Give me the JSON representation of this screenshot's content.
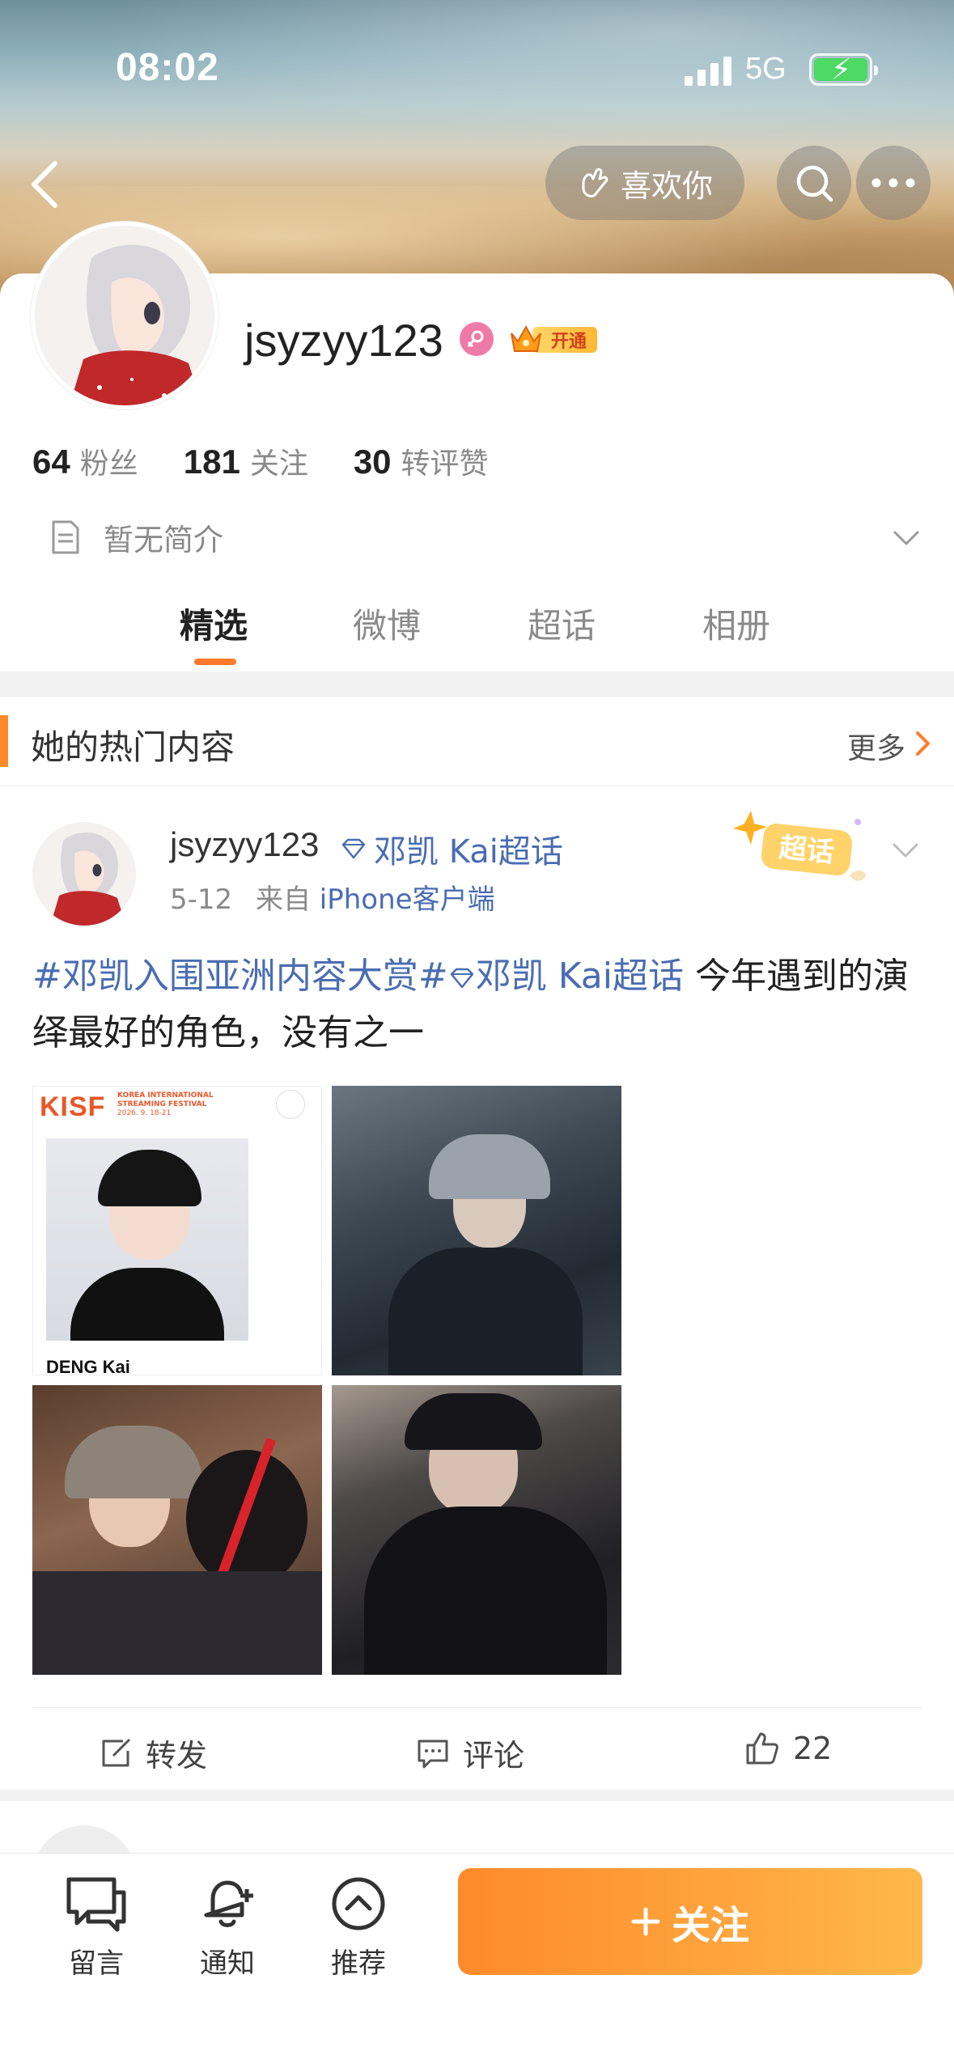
{
  "status_bar": {
    "time": "08:02",
    "network": "5G"
  },
  "header": {
    "like_button": "喜欢你"
  },
  "profile": {
    "username": "jsyzyy123",
    "vip_label": "开通",
    "stats": [
      {
        "num": "64",
        "label": "粉丝"
      },
      {
        "num": "181",
        "label": "关注"
      },
      {
        "num": "30",
        "label": "转评赞"
      }
    ],
    "bio": "暂无简介"
  },
  "tabs": [
    "精选",
    "微博",
    "超话",
    "相册"
  ],
  "section": {
    "title": "她的热门内容",
    "more": "更多"
  },
  "post": {
    "author": "jsyzyy123",
    "topic": "邓凯 Kai超话",
    "date": "5-12",
    "from_prefix": "来自",
    "source": "iPhone客户端",
    "sticker": "超话",
    "tag1": "#邓凯入围亚洲内容大赏#",
    "tag2": "邓凯 Kai超话",
    "text": " 今年遇到的演绎最好的角色，没有之一",
    "img1_header": "KISF",
    "img1_sub": "KOREA INTERNATIONAL STREAMING FESTIVAL",
    "img1_date": "2026. 9. 18-21",
    "img1_caption": "DENG Kai",
    "actions": {
      "repost": "转发",
      "comment": "评论",
      "like_count": "22"
    }
  },
  "bottom_bar": {
    "message": "留言",
    "notify": "通知",
    "recommend": "推荐",
    "follow": "关注"
  },
  "colors": {
    "accent": "#ff8a2a",
    "link": "#4a6db3"
  }
}
